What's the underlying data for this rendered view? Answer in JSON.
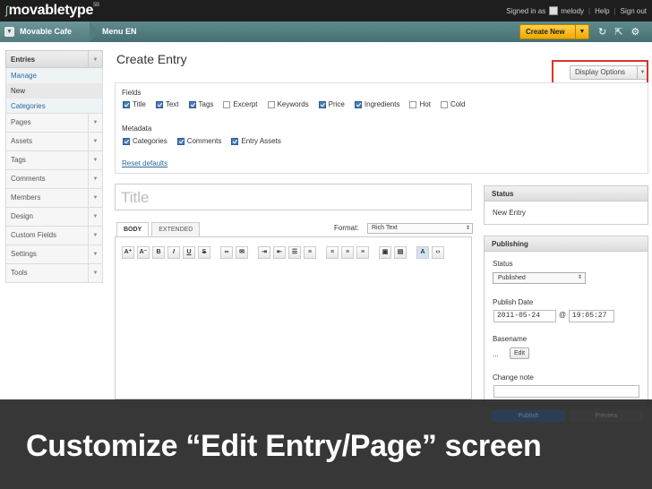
{
  "header": {
    "logo_prefix": "ʃ",
    "logo": "movabletype",
    "logo_tm": "5B",
    "signed_in_as": "Signed in as",
    "username": "melody",
    "help": "Help",
    "sign_out": "Sign out"
  },
  "nav": {
    "blog_name": "Movable Cafe",
    "crumb": "Menu EN",
    "create_new": "Create New"
  },
  "sidebar": {
    "entries": {
      "label": "Entries",
      "subitems": [
        "Manage",
        "New",
        "Categories"
      ]
    },
    "items": [
      "Pages",
      "Assets",
      "Tags",
      "Comments",
      "Members",
      "Design",
      "Custom Fields",
      "Settings",
      "Tools"
    ]
  },
  "main": {
    "title": "Create Entry",
    "display_options": "Display Options",
    "fields_label": "Fields",
    "fields": [
      {
        "label": "Title",
        "checked": true
      },
      {
        "label": "Text",
        "checked": true
      },
      {
        "label": "Tags",
        "checked": true
      },
      {
        "label": "Excerpt",
        "checked": false
      },
      {
        "label": "Keywords",
        "checked": false
      },
      {
        "label": "Price",
        "checked": true
      },
      {
        "label": "Ingredients",
        "checked": true
      },
      {
        "label": "Hot",
        "checked": false
      },
      {
        "label": "Cold",
        "checked": false
      }
    ],
    "metadata_label": "Metadata",
    "metadata": [
      {
        "label": "Categories",
        "checked": true
      },
      {
        "label": "Comments",
        "checked": true
      },
      {
        "label": "Entry Assets",
        "checked": true
      }
    ],
    "reset": "Reset defaults",
    "title_placeholder": "Title",
    "tab_body": "BODY",
    "tab_extended": "EXTENDED",
    "format_label": "Format:",
    "format_value": "Rich Text"
  },
  "status_panel": {
    "title": "Status",
    "value": "New Entry"
  },
  "publishing": {
    "title": "Publishing",
    "status_label": "Status",
    "status_value": "Published",
    "date_label": "Publish Date",
    "date": "2011-05-24",
    "at": "@",
    "time": "19:05:27",
    "basename_label": "Basename",
    "basename_value": "...",
    "edit": "Edit",
    "change_note": "Change note",
    "publish": "Publish",
    "preview": "Preview"
  },
  "caption": "Customize “Edit Entry/Page” screen"
}
